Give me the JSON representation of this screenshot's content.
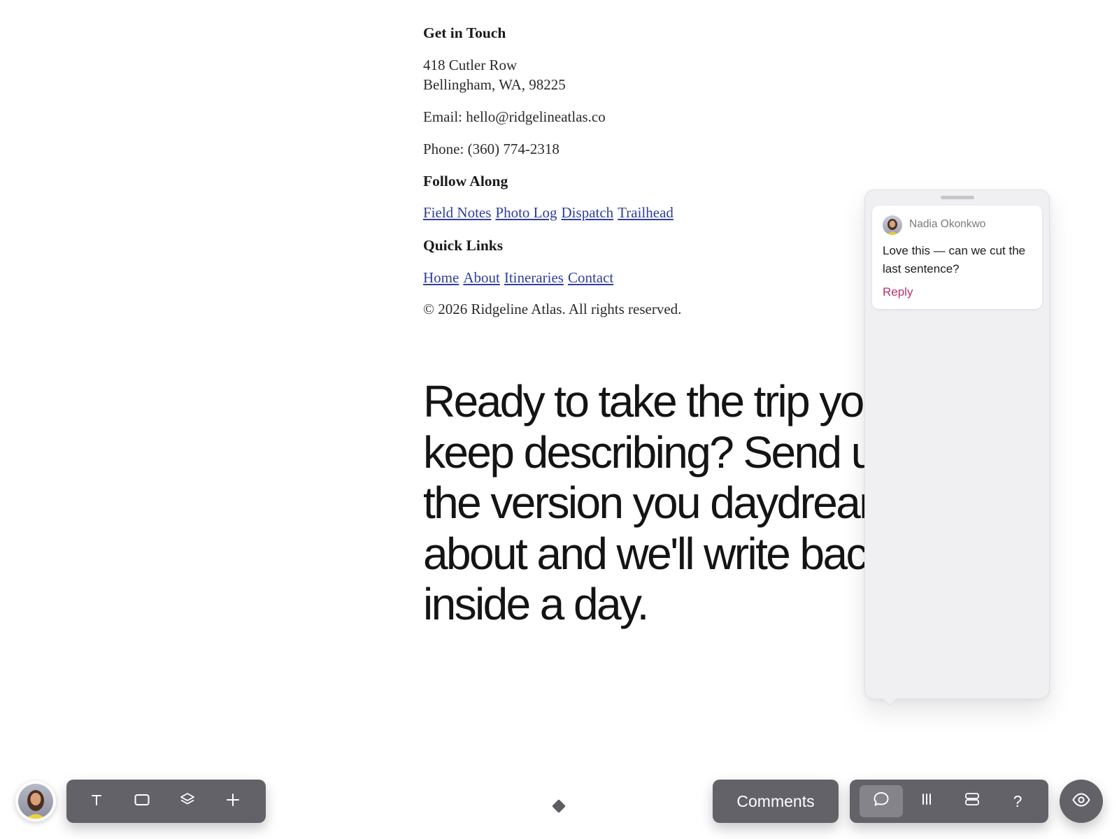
{
  "contact": {
    "heading": "Get in Touch",
    "address_line1": "418 Cutler Row",
    "address_line2": "Bellingham, WA, 98225",
    "email": "Email: hello@ridgelineatlas.co",
    "phone": "Phone: (360) 774-2318"
  },
  "follow": {
    "heading": "Follow Along",
    "links": [
      "Field Notes",
      "Photo Log",
      "Dispatch",
      "Trailhead"
    ]
  },
  "quick_links": {
    "heading": "Quick Links",
    "links": [
      "Home",
      "About",
      "Itineraries",
      "Contact"
    ]
  },
  "copyright": "© 2026 Ridgeline Atlas. All rights reserved.",
  "headline": "Ready to take the trip you keep describing? Send us the version you daydream about and we'll write back inside a day.",
  "comment": {
    "author": "Nadia Okonkwo",
    "text": "Love this — can we cut the last sentence?",
    "reply_label": "Reply"
  },
  "toolbar": {
    "tools": [
      {
        "name": "text-tool",
        "icon": "text-icon"
      },
      {
        "name": "shape-tool",
        "icon": "rectangle-icon"
      },
      {
        "name": "layers-tool",
        "icon": "layers-icon"
      },
      {
        "name": "add-tool",
        "icon": "plus-icon"
      }
    ],
    "comments_label": "Comments",
    "modes": [
      {
        "name": "comment-mode",
        "icon": "speech-bubble-icon",
        "active": true
      },
      {
        "name": "columns-mode",
        "icon": "columns-icon",
        "active": false
      },
      {
        "name": "rows-mode",
        "icon": "rows-icon",
        "active": false
      },
      {
        "name": "help",
        "icon": "question-icon",
        "label": "?",
        "active": false
      }
    ],
    "preview_icon": "eye-icon"
  },
  "colors": {
    "link": "#2f3f9a",
    "reply_accent": "#b8336a",
    "toolbar_bg": "#636269",
    "panel_bg": "#f0f0f2"
  }
}
